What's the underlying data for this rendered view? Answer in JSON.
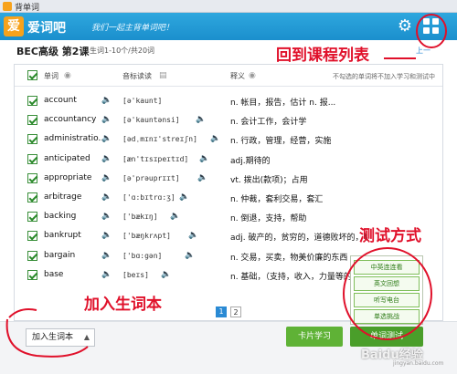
{
  "window": {
    "title": "背单词"
  },
  "header": {
    "logo_glyph": "爱",
    "logo_text": "爱词吧",
    "slogan": "我们一起主背单词吧！",
    "settings_icon": "gear-icon",
    "course_list_icon": "grid-icon"
  },
  "course": {
    "title": "BEC高级 第2课",
    "subtitle": "生词1-10个/共20词",
    "back_link": "上一"
  },
  "table": {
    "headers": {
      "word": "单词",
      "phonetic": "音标读读",
      "definition": "释义",
      "note": "不勾选的单词将不加入学习和测试中"
    },
    "rows": [
      {
        "word": "account",
        "phonetic": "[ə'kaunt]",
        "definition": "n. 帐目，报告，估计 n. 报..."
      },
      {
        "word": "accountancy",
        "phonetic": "[ə'kauntənsi]",
        "definition": "n. 会计工作，会计学"
      },
      {
        "word": "administratio...",
        "phonetic": "[ədˌmɪnɪ'streɪʃn]",
        "definition": "n. 行政，管理，经营，实施"
      },
      {
        "word": "anticipated",
        "phonetic": "[æn'tɪsɪpeɪtɪd]",
        "definition": "adj.期待的"
      },
      {
        "word": "appropriate",
        "phonetic": "[ə'prəuprɪɪt]",
        "definition": "vt. 拨出(款项)；占用"
      },
      {
        "word": "arbitrage",
        "phonetic": "['ɑ:bɪtrɑ:ʒ]",
        "definition": "n. 仲裁，套利交易，套汇"
      },
      {
        "word": "backing",
        "phonetic": "['bækɪŋ]",
        "definition": "n. 倒退，支持，帮助"
      },
      {
        "word": "bankrupt",
        "phonetic": "['bæŋkrʌpt]",
        "definition": "adj. 破产的，贫穷的，道德败坏的，枯"
      },
      {
        "word": "bargain",
        "phonetic": "['bɑ:gən]",
        "definition": "n. 交易，买卖，物美价廉的东西 v..."
      },
      {
        "word": "base",
        "phonetic": "[beɪs]",
        "definition": "n. 基础，（支持，收入，力量等的）"
      }
    ]
  },
  "pagination": {
    "pages": [
      "1",
      "2"
    ],
    "current": "1"
  },
  "footer": {
    "add_button": "加入生词本",
    "add_caret": "▲",
    "card_button": "卡片学习",
    "test_button": "单词测试"
  },
  "test_menu": {
    "options": [
      "中英连连看",
      "英文回想",
      "听写电台",
      "单选挑战"
    ]
  },
  "annotations": {
    "course_list": "回到课程列表",
    "test_mode": "测试方式",
    "add_wordbook": "加入生词本"
  },
  "watermark": {
    "main": "Baidu经验",
    "sub": "jingyan.baidu.com"
  },
  "colors": {
    "header_blue": "#1b8fcd",
    "accent_green": "#5fb236",
    "annotation_red": "#e0102a",
    "link_blue": "#2a8ad4"
  }
}
